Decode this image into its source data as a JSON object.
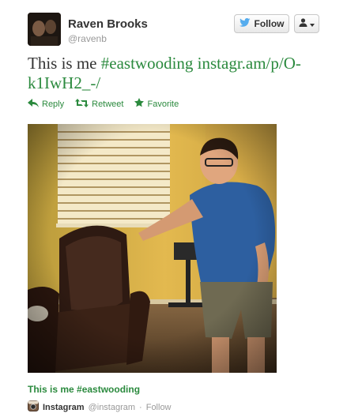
{
  "author": {
    "name": "Raven Brooks",
    "handle": "@ravenb"
  },
  "buttons": {
    "follow_label": "Follow"
  },
  "tweet": {
    "text_prefix": "This is me ",
    "hashtag": "#eastwooding",
    "link": "instagr.am/p/O-k1IwH2_-/"
  },
  "actions": {
    "reply": "Reply",
    "retweet": "Retweet",
    "favorite": "Favorite"
  },
  "caption": "This is me #eastwooding",
  "source": {
    "name": "Instagram",
    "handle": "@instagram",
    "separator": "·",
    "follow": "Follow"
  },
  "icons": {
    "twitter_bird": "twitter-bird-icon",
    "user": "user-icon",
    "reply": "reply-arrow-icon",
    "retweet": "retweet-icon",
    "favorite": "star-icon",
    "instagram": "instagram-icon"
  },
  "colors": {
    "link_green": "#2b8a3e",
    "twitter_blue": "#55acee"
  }
}
